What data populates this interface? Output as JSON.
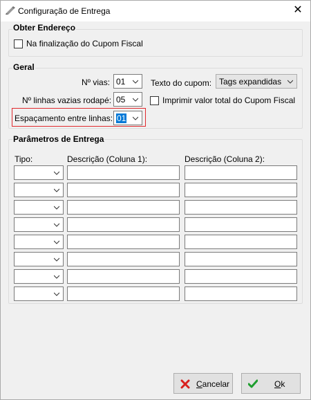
{
  "window": {
    "title": "Configuração de Entrega",
    "close_glyph": "✕"
  },
  "obter_endereco": {
    "title": "Obter Endereço",
    "checkbox_label": "Na finalização do Cupom Fiscal",
    "checked": false
  },
  "geral": {
    "title": "Geral",
    "vias_label": "Nº vias:",
    "vias_value": "01",
    "linhas_label": "Nº linhas vazias rodapé:",
    "linhas_value": "05",
    "espacamento_label": "Espaçamento entre linhas:",
    "espacamento_value": "01",
    "texto_cupom_label": "Texto do cupom:",
    "texto_cupom_value": "Tags expandidas",
    "imprimir_label": "Imprimir valor total do Cupom Fiscal",
    "imprimir_checked": false
  },
  "parametros": {
    "title": "Parâmetros de Entrega",
    "col_tipo": "Tipo:",
    "col_desc1": "Descrição (Coluna 1):",
    "col_desc2": "Descrição (Coluna 2):",
    "rows": [
      {
        "tipo": "",
        "desc1": "",
        "desc2": ""
      },
      {
        "tipo": "",
        "desc1": "",
        "desc2": ""
      },
      {
        "tipo": "",
        "desc1": "",
        "desc2": ""
      },
      {
        "tipo": "",
        "desc1": "",
        "desc2": ""
      },
      {
        "tipo": "",
        "desc1": "",
        "desc2": ""
      },
      {
        "tipo": "",
        "desc1": "",
        "desc2": ""
      },
      {
        "tipo": "",
        "desc1": "",
        "desc2": ""
      },
      {
        "tipo": "",
        "desc1": "",
        "desc2": ""
      }
    ]
  },
  "buttons": {
    "cancel": "Cancelar",
    "ok": "Ok"
  },
  "colors": {
    "highlight": "#e0282c",
    "selection": "#0078d7",
    "cancel_icon": "#d9201e",
    "ok_icon": "#1e9e2e"
  },
  "icons": {
    "app": "pen-icon",
    "close": "close-icon",
    "cancel": "x-icon",
    "ok": "checkmark-icon"
  }
}
